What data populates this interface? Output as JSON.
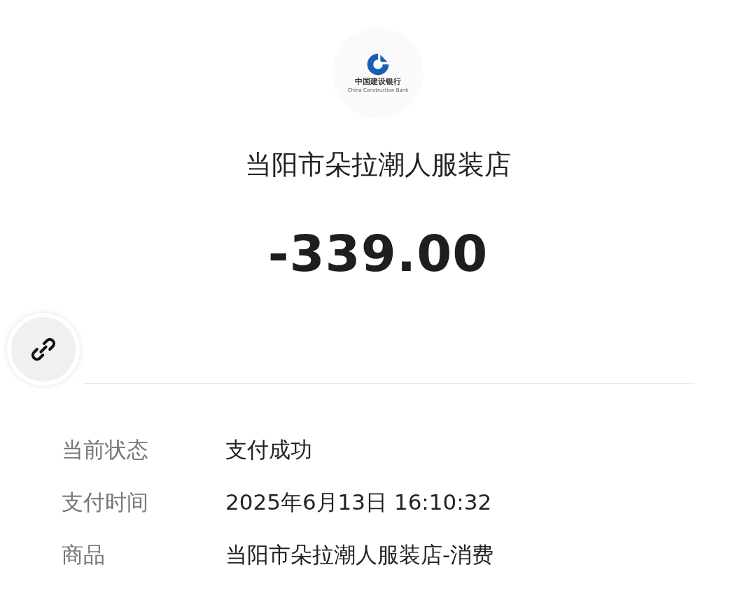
{
  "bank_logo": {
    "name_cn": "中国建设银行",
    "name_en": "China Construction Bank"
  },
  "merchant": "当阳市朵拉潮人服装店",
  "amount": "-339.00",
  "details": [
    {
      "label": "当前状态",
      "value": "支付成功"
    },
    {
      "label": "支付时间",
      "value": "2025年6月13日 16:10:32"
    },
    {
      "label": "商品",
      "value": "当阳市朵拉潮人服装店-消费"
    }
  ]
}
